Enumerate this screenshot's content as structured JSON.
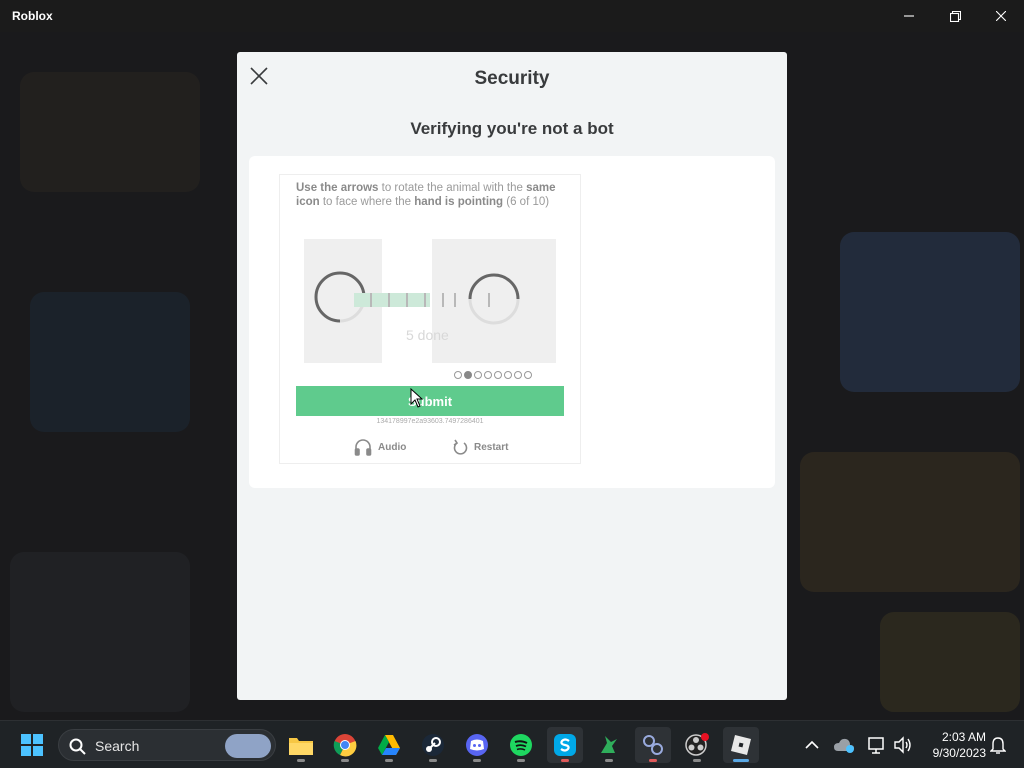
{
  "window": {
    "title": "Roblox"
  },
  "modal": {
    "title": "Security",
    "subtitle": "Verifying you're not a bot"
  },
  "captcha": {
    "instruction_parts": [
      "Use the arrows",
      " to rotate the animal with the ",
      "same icon",
      " to face where the ",
      "hand is pointing",
      " (6 of 10)"
    ],
    "done_text": "5 done",
    "total_dots": 8,
    "active_dot": 1,
    "submit_label": "Submit",
    "session_id": "134178997e2a93603.7497286401",
    "audio_label": "Audio",
    "restart_label": "Restart"
  },
  "taskbar": {
    "search_placeholder": "Search",
    "apps": [
      "file-explorer-icon",
      "chrome-icon",
      "google-drive-icon",
      "steam-icon",
      "discord-icon",
      "spotify-icon",
      "skype-icon",
      "bird-app-icon",
      "gamepad-app-icon",
      "obs-icon",
      "roblox-icon"
    ],
    "time": "2:03 AM",
    "date": "9/30/2023"
  },
  "colors": {
    "submit_green": "#5fcb8d",
    "modal_bg": "#f2f4f5",
    "taskbar_bg": "#1f2326"
  }
}
